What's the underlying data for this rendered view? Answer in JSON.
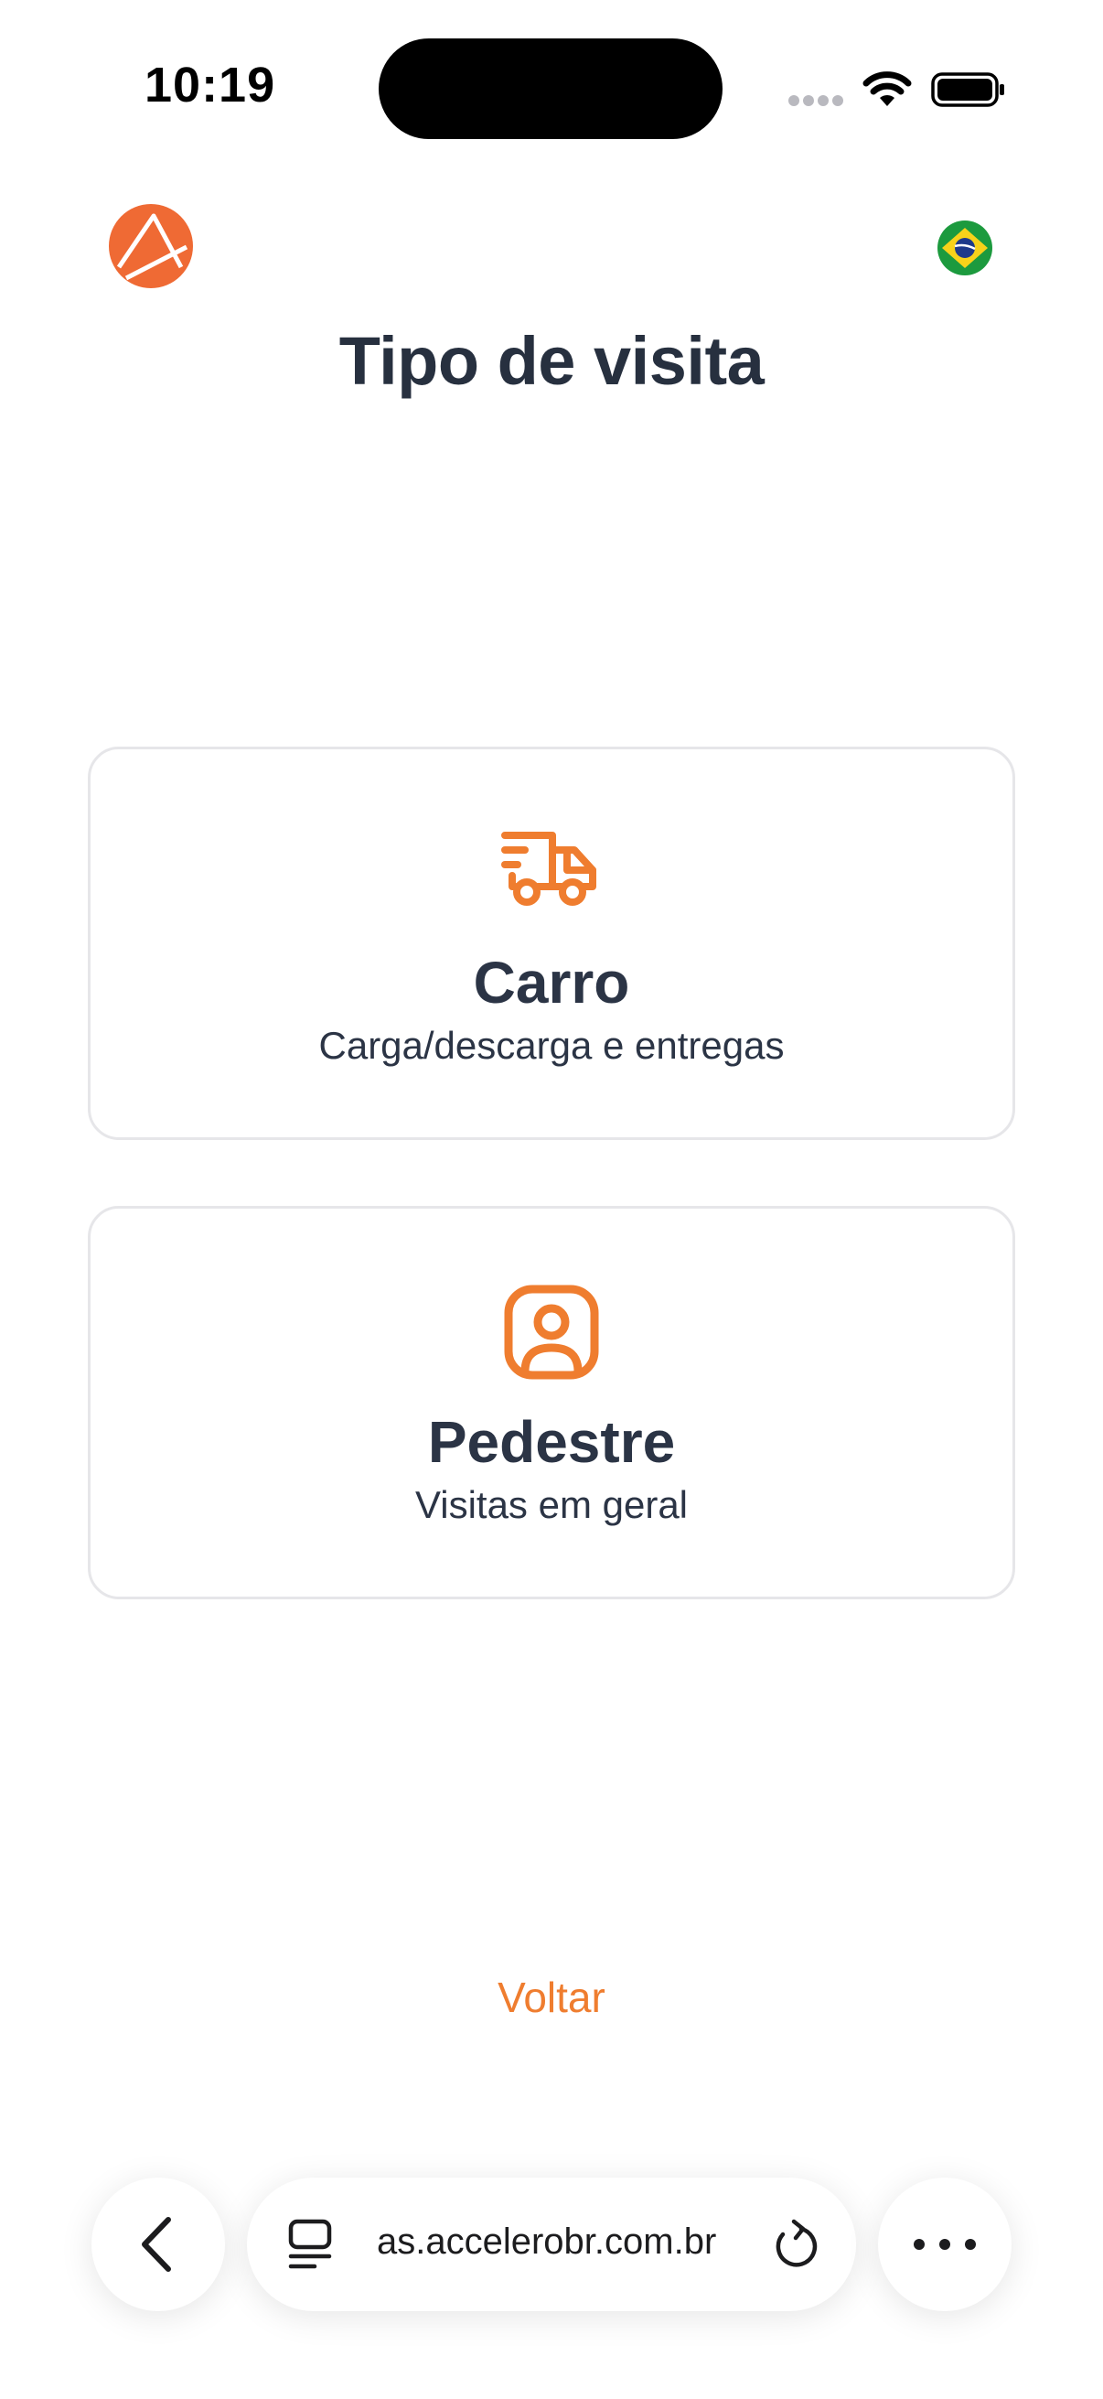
{
  "status_bar": {
    "time": "10:19"
  },
  "header": {
    "title": "Tipo de visita"
  },
  "options": [
    {
      "title": "Carro",
      "subtitle": "Carga/descarga e entregas",
      "icon": "truck-icon"
    },
    {
      "title": "Pedestre",
      "subtitle": "Visitas em geral",
      "icon": "user-portrait-icon"
    }
  ],
  "back_label": "Voltar",
  "browser": {
    "url": "as.accelerobr.com.br"
  },
  "colors": {
    "accent": "#EF7D2F",
    "text": "#2B3445",
    "card_border": "#E6E6E9"
  }
}
